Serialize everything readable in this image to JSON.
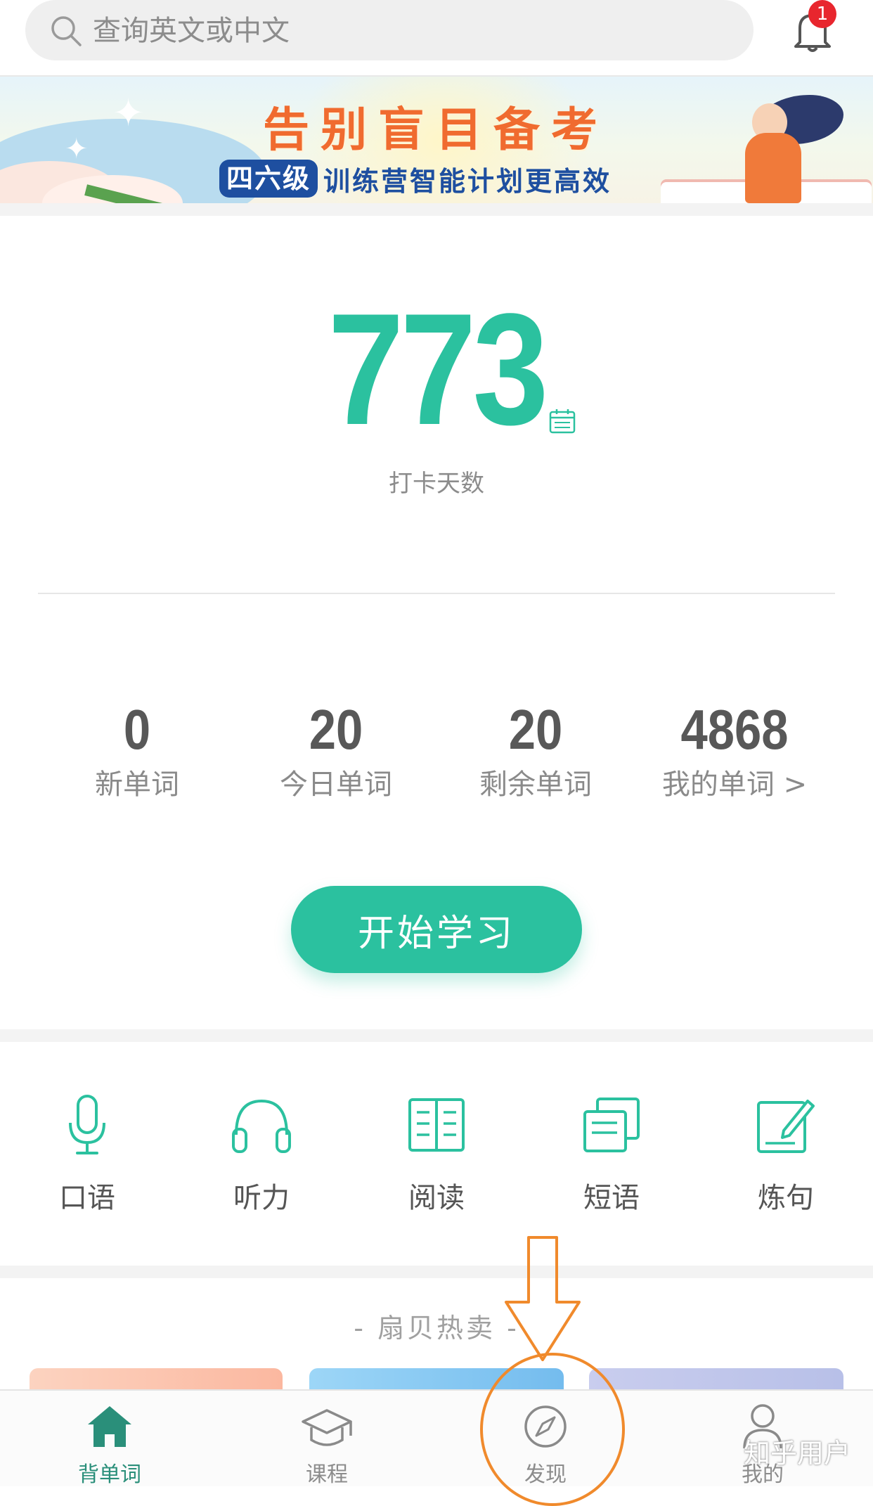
{
  "search": {
    "placeholder": "查询英文或中文"
  },
  "notifications": {
    "badge": "1"
  },
  "banner": {
    "title": "告别盲目备考",
    "tag": "四六级",
    "subtitle": "训练营智能计划更高效"
  },
  "checkin": {
    "days": "773",
    "label": "打卡天数"
  },
  "stats": [
    {
      "value": "0",
      "label": "新单词"
    },
    {
      "value": "20",
      "label": "今日单词"
    },
    {
      "value": "20",
      "label": "剩余单词"
    },
    {
      "value": "4868",
      "label": "我的单词 >"
    }
  ],
  "start_button": {
    "label": "开始学习"
  },
  "features": [
    {
      "label": "口语",
      "icon": "microphone-icon"
    },
    {
      "label": "听力",
      "icon": "headphones-icon"
    },
    {
      "label": "阅读",
      "icon": "book-icon"
    },
    {
      "label": "短语",
      "icon": "cards-icon"
    },
    {
      "label": "炼句",
      "icon": "edit-icon"
    }
  ],
  "hot_sale": {
    "title": "- 扇贝热卖 -"
  },
  "nav": [
    {
      "label": "背单词",
      "icon": "home-icon",
      "active": true
    },
    {
      "label": "课程",
      "icon": "graduation-cap-icon",
      "active": false
    },
    {
      "label": "发现",
      "icon": "compass-icon",
      "active": false
    },
    {
      "label": "我的",
      "icon": "user-icon",
      "active": false
    }
  ],
  "watermark": "知乎用户",
  "colors": {
    "accent": "#2bc19f",
    "annotation": "#f08a2c",
    "badge": "#e8262e"
  }
}
